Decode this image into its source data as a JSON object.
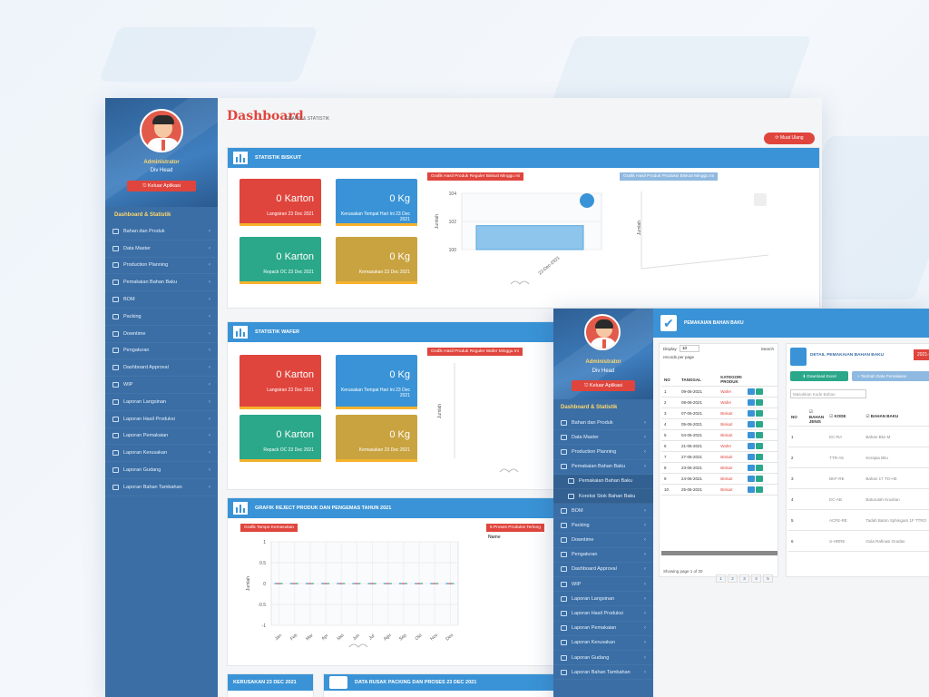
{
  "app": {
    "title": "Dashboard",
    "subtitle": "GRAFIS & STATISTIK",
    "reload_label": "Muat Ulang"
  },
  "user": {
    "name": "Administrator",
    "role": "Div Head",
    "logout_label": "Keluar Aplikasi"
  },
  "sidebar": {
    "header": "Dashboard & Statistik",
    "items": [
      {
        "label": "Bahan dan Produk",
        "icon": "grid-icon"
      },
      {
        "label": "Data Master",
        "icon": "database-icon"
      },
      {
        "label": "Production Planning",
        "icon": "calendar-icon"
      },
      {
        "label": "Pemakaian Bahan Baku",
        "icon": "list-icon"
      },
      {
        "label": "BOM",
        "icon": "clipboard-icon"
      },
      {
        "label": "Packing",
        "icon": "box-icon"
      },
      {
        "label": "Downtime",
        "icon": "clock-icon"
      },
      {
        "label": "Pengaturan",
        "icon": "gear-icon"
      },
      {
        "label": "Dashboard Approval",
        "icon": "check-icon"
      },
      {
        "label": "WIP",
        "icon": "layers-icon"
      },
      {
        "label": "Laporan Langsinan",
        "icon": "report-icon"
      },
      {
        "label": "Laporan Hasil Produksi",
        "icon": "report-icon"
      },
      {
        "label": "Laporan Pemakaian",
        "icon": "report-icon"
      },
      {
        "label": "Laporan Kerusakan",
        "icon": "report-icon"
      },
      {
        "label": "Laporan Gudang",
        "icon": "report-icon"
      },
      {
        "label": "Laporan Bahan Tambahan",
        "icon": "report-icon"
      }
    ]
  },
  "biskuit": {
    "title": "STATISTIK BISKUIT",
    "cards": [
      {
        "value": "0 Karton",
        "label": "Langsiran 23 Dec 2021",
        "color": "#e0453d"
      },
      {
        "value": "0 Kg",
        "label": "Kerusakan Tempat Hari Ini 23 Dec 2021",
        "color": "#3a93d6"
      },
      {
        "value": "0 Karton",
        "label": "Repack OC 23 Dec 2021",
        "color": "#2aa889"
      },
      {
        "value": "0 Kg",
        "label": "Kemasukan 23 Dec 2021",
        "color": "#c9a340"
      }
    ],
    "chart1_title": "Grafik Hasil Produk Reguler Biskuit Minggu Ini",
    "chart2_title": "Grafik Hasil Produk Produksi Biskuit Minggu Ini",
    "ylabel": "Jumlah",
    "xlabel": "23-Dec-2021"
  },
  "wafer": {
    "title": "STATISTIK WAFER",
    "cards": [
      {
        "value": "0 Karton",
        "label": "Langsiran 23 Dec 2021"
      },
      {
        "value": "0 Kg",
        "label": "Kerusakan Tempat Hari Ini 23 Dec 2021"
      },
      {
        "value": "0 Karton",
        "label": "Repack OC 23 Dec 2021"
      },
      {
        "value": "0 Kg",
        "label": "Kemasukan 23 Dec 2021"
      }
    ],
    "chart_title": "Grafik Hasil Produk Reguler Wafer Minggu Ini",
    "ylabel": "Jumlah"
  },
  "reject": {
    "title": "GRAFIK REJECT PRODUK DAN PENGEMAS TAHUN 2021",
    "chart_title": "Grafik Tampo Kemasukan",
    "side_title": "5 Proses Produksi Terlong",
    "side_col": "Name",
    "ylabel": "Jumlah"
  },
  "bottom": {
    "left_title": "KERUSAKAN 23 DEC 2021",
    "right_title": "DATA RUSAK PACKING DAN PROSES 23 DEC 2021"
  },
  "chart_data": [
    {
      "type": "bar",
      "title": "Grafik Hasil Produk Reguler Biskuit Minggu Ini",
      "categories": [
        "23-Dec-2021"
      ],
      "values": [
        101.7
      ],
      "ylabel": "Jumlah",
      "ylim": [
        100,
        104
      ],
      "yticks": [
        "100",
        "102",
        "104"
      ]
    },
    {
      "type": "line",
      "title": "Grafik Tampo Kemasukan",
      "categories": [
        "Jan",
        "Feb",
        "Mar",
        "Apr",
        "Mei",
        "Jun",
        "Jul",
        "Agu",
        "Sep",
        "Okt",
        "Nov",
        "Des"
      ],
      "values": [
        0,
        0,
        0,
        0,
        0,
        0,
        0,
        0,
        0,
        0,
        0,
        0
      ],
      "ylabel": "Jumlah",
      "ylim": [
        -1,
        1
      ],
      "yticks": [
        "1",
        "0.5",
        "0",
        "-0.5",
        "-1"
      ]
    }
  ],
  "window2": {
    "section_title": "PEMAKAIAN BAHAN BAKU",
    "display_label": "Display",
    "display_value": "10",
    "records_label": "records per page",
    "search_label": "Search",
    "columns": [
      "NO",
      "TANGGAL",
      "KATEGORI PRODUK"
    ],
    "rows": [
      {
        "no": "1",
        "date": "09-06-2021",
        "cat": "Wafer"
      },
      {
        "no": "2",
        "date": "08-06-2021",
        "cat": "Wafer"
      },
      {
        "no": "3",
        "date": "07-06-2021",
        "cat": "Biskuit"
      },
      {
        "no": "4",
        "date": "05-06-2021",
        "cat": "Biskuit"
      },
      {
        "no": "5",
        "date": "04-06-2021",
        "cat": "Biskuit"
      },
      {
        "no": "6",
        "date": "21-06-2021",
        "cat": "Wafer"
      },
      {
        "no": "7",
        "date": "27-06-2021",
        "cat": "Biskuit"
      },
      {
        "no": "8",
        "date": "23-06-2021",
        "cat": "Biskuit"
      },
      {
        "no": "9",
        "date": "24-06-2021",
        "cat": "Biskuit"
      },
      {
        "no": "10",
        "date": "25-06-2021",
        "cat": "Biskuit"
      }
    ],
    "showing": "Showing page 1 of 20",
    "pages": [
      "1",
      "2",
      "3",
      "4",
      "5"
    ],
    "detail_title": "DETAIL PEMAKAIAN BAHAN BAKU",
    "detail_date": "2021-0",
    "download_label": "Download Excel",
    "add_label": "Tambah Data Pemakaian",
    "detail_search": "Masukkan Kode Bahan",
    "detail_cols": [
      "NO",
      "BAHAN JENIS",
      "KODE",
      "BAHAN BAKU"
    ],
    "detail_rows": [
      {
        "no": "1",
        "kode": "EC-RA",
        "bahan": "Bahan Bku M"
      },
      {
        "no": "2",
        "kode": "TTR-A5",
        "bahan": "Kerajaa Bku"
      },
      {
        "no": "3",
        "kode": "BKF-RE",
        "bahan": "Bahan 17 TO-HE"
      },
      {
        "no": "4",
        "kode": "EC-AB",
        "bahan": "Baturutah Krusitan"
      },
      {
        "no": "5",
        "kode": "ACFE-RE",
        "bahan": "Tadah Baton Sphingam 1F TTRO"
      },
      {
        "no": "6",
        "kode": "S-HRRE",
        "bahan": "Gula Rafinasi Gradas"
      }
    ],
    "sidebar_sub": [
      "Pemakaian Bahan Baku",
      "Koreksi Stok Bahan Baku"
    ]
  }
}
